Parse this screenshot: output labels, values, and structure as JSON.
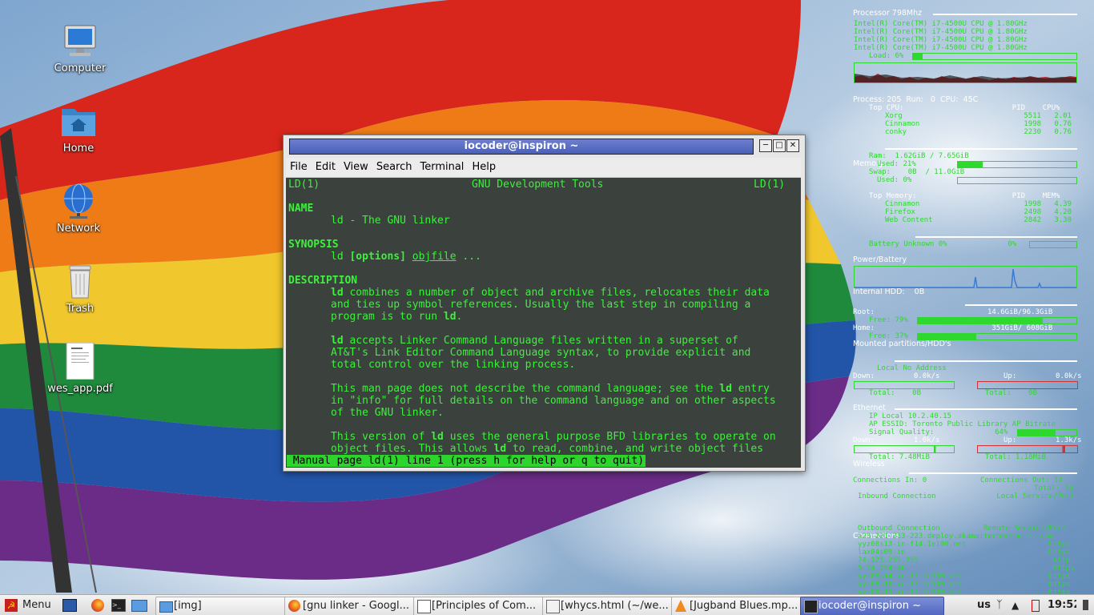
{
  "desktop": {
    "icons": [
      {
        "label": "Computer",
        "icon": "computer-icon"
      },
      {
        "label": "Home",
        "icon": "home-folder-icon"
      },
      {
        "label": "Network",
        "icon": "network-globe-icon"
      },
      {
        "label": "Trash",
        "icon": "trash-icon"
      },
      {
        "label": "wes_app.pdf",
        "icon": "pdf-file-icon"
      }
    ]
  },
  "terminal": {
    "title": "iocoder@inspiron ~",
    "menu": [
      "File",
      "Edit",
      "View",
      "Search",
      "Terminal",
      "Help"
    ],
    "header_left": "LD(1)",
    "header_center": "GNU Development Tools",
    "header_right": "LD(1)",
    "name_heading": "NAME",
    "name_text": "ld - The GNU linker",
    "synopsis_heading": "SYNOPSIS",
    "synopsis_cmd": "ld",
    "synopsis_options": "[options]",
    "synopsis_objfile": "objfile",
    "synopsis_tail": "...",
    "description_heading": "DESCRIPTION",
    "p1_l1": "combines a number of object and archive files, relocates their data",
    "p1_l2": "and ties up symbol references. Usually the last step in compiling a",
    "p1_l3": "program is to run",
    "p2_l1": "accepts Linker Command Language files written in a superset of",
    "p2_l2": "AT&T's Link Editor Command Language syntax, to provide explicit and",
    "p2_l3": "total control over the linking process.",
    "p3_l1a": "This man page does not describe the command language; see the",
    "p3_l1b": "entry",
    "p3_l2": "in \"info\" for full details on the command language and on other aspects",
    "p3_l3": "of the GNU linker.",
    "p4_l1a": "This version of",
    "p4_l1b": "uses the general purpose BFD libraries to operate on",
    "p4_l2a": "object files. This allows",
    "p4_l2b": "to read, combine, and write object files",
    "ld": "ld",
    "period": ".",
    "status": " Manual page ld(1) line 1 (press h for help or q to quit)"
  },
  "conky": {
    "processor_heading": "Processor 798Mhz",
    "cpu_lines": [
      "Intel(R) Core(TM) i7-4500U CPU @ 1.80GHz",
      "Intel(R) Core(TM) i7-4500U CPU @ 1.80GHz",
      "Intel(R) Core(TM) i7-4500U CPU @ 1.80GHz",
      "Intel(R) Core(TM) i7-4500U CPU @ 1.80GHz"
    ],
    "load": "Load: 6%",
    "load_fraction": 0.06,
    "process_line": "Process: 205  Run:   0  CPU:  45C",
    "top_cpu_header": "Top CPU:                         PID    CPU%",
    "top_cpu_rows": [
      "Xorg                            5511   2.01",
      "Cinnamon                        1998   0.76",
      "conky                           2230   0.76"
    ],
    "memory_heading": "Memory",
    "ram": "Ram:  1.62GiB / 7.65GiB",
    "used": "Used: 21%",
    "used_fraction": 0.21,
    "swap": "Swap:    0B  / 11.0GiB",
    "swap_used": "Used: 0%",
    "top_mem_header": "Top Memory:                      PID    MEM%",
    "top_mem_rows": [
      "Cinnamon                        1998   4.39",
      "Firefox                         2498   4.20",
      "Web Content                     2842   3.30"
    ],
    "power_heading": "Power/Battery",
    "battery": "Battery Unknown 0%              0%",
    "hdd_heading": "Internal HDD:    0B",
    "mounted_heading": "Mounted partitions/HDD's",
    "root": "Root:                          14.6GiB/96.3GiB",
    "root_free": "Free: 79%",
    "root_fraction": 0.79,
    "home": "Home:                           351GiB/ 608GiB",
    "home_free": "Free: 37%",
    "home_fraction": 0.37,
    "ethernet_heading": "Ethernet",
    "eth_local": "Local No Address",
    "eth_down": "Down:         0.0k/s",
    "eth_up": "Up:         0.0k/s",
    "eth_total_down": "Total:    0B",
    "eth_total_up": "Total:    0B",
    "wireless_heading": "Wireless",
    "wl_ip": "IP Local 10.2.40.15",
    "wl_essid": "AP ESSID: Toronto Public Library AP Bitrate",
    "wl_signal": "Signal Quality:              64%",
    "wl_signal_fraction": 0.64,
    "wl_down": "Down:         1.0k/s",
    "wl_up": "Up:         1.3k/s",
    "wl_total_down": "Total: 7.48MiB",
    "wl_total_up": "Total: 1.18MiB",
    "connections_heading": "Connections",
    "conn_in": "Connections In: 0",
    "conn_out": "Connections Out: 14",
    "conn_total": "Total: 14",
    "inbound_header": "Inbound Connection              Local Service/Port",
    "outbound_header": "Outbound Connection          Remote Service/Port",
    "outbound_rows": [
      "a23-221-213-223.deploy.akamaitechnologies.com",
      "yyz08s13-in-f14.1e100.net                   https",
      "lax04s09-in                                 https",
      "74.125.255.255                               http",
      "5.14.254.46                                  https",
      "yyz08s14-in-f3.1e100.net                    https",
      "yyz08s10-in-f3.1e100.net                    https",
      "yyz08s15-in-f3.1e100.net                    https"
    ]
  },
  "taskbar": {
    "menu_label": "Menu",
    "tasks": [
      {
        "label": "[img]",
        "icon": "folder-icon"
      },
      {
        "label": "[gnu linker - Googl...",
        "icon": "firefox-icon"
      },
      {
        "label": "[Principles of Com...",
        "icon": "document-viewer-icon"
      },
      {
        "label": "[whycs.html (~/we...",
        "icon": "text-editor-icon"
      },
      {
        "label": "[Jugband Blues.mp...",
        "icon": "vlc-icon"
      },
      {
        "label": "iocoder@inspiron ~",
        "icon": "terminal-icon"
      }
    ],
    "keyboard_layout": "us",
    "clock": "19:52"
  }
}
